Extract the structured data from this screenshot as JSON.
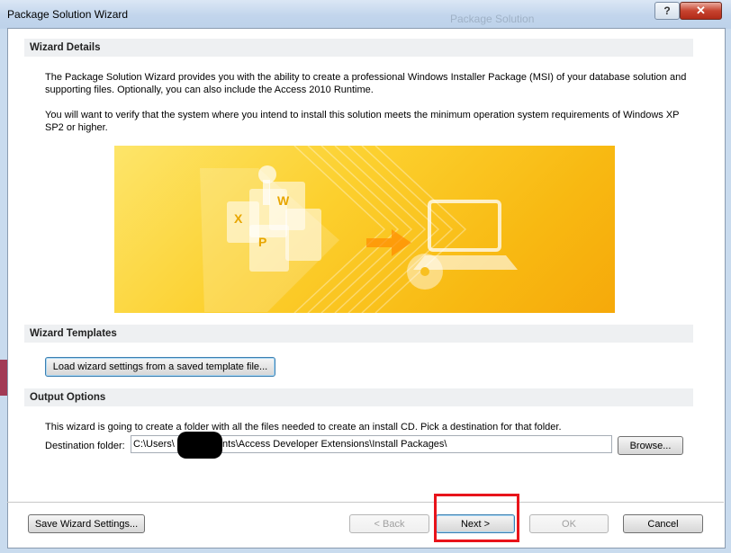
{
  "window": {
    "title": "Package Solution Wizard",
    "ghost_title": "Package Solution",
    "help_label": "?",
    "close_label": "✕"
  },
  "sections": {
    "details": {
      "header": "Wizard Details",
      "para1_line1": "The Package Solution Wizard provides you with the ability to create a professional Windows Installer Package (MSI) of your database solution and",
      "para1_line2": "supporting files.  Optionally, you can also include the Access 2010 Runtime.",
      "para2_line1": "You will want to verify that the system where you intend to install this solution meets the minimum operation system requirements of Windows XP",
      "para2_line2": "SP2 or higher."
    },
    "templates": {
      "header": "Wizard Templates",
      "load_button": "Load wizard settings from a saved template file..."
    },
    "output": {
      "header": "Output Options",
      "description": "This wizard is going to create a folder with all the files needed to create an install CD.  Pick a destination for that folder.",
      "destination_label": "Destination folder:",
      "destination_value": "C:\\Users\\         d\\Documents\\Access Developer Extensions\\Install Packages\\",
      "browse_button": "Browse..."
    }
  },
  "footer": {
    "save_button": "Save Wizard Settings...",
    "back_button": "< Back",
    "next_button": "Next >",
    "ok_button": "OK",
    "cancel_button": "Cancel"
  },
  "icons": {
    "banner": "package-files-to-computer-illustration",
    "help": "help-icon",
    "close": "close-icon"
  },
  "colors": {
    "banner_start": "#fde56a",
    "banner_end": "#f6a90a",
    "highlight": "#e8141b"
  }
}
